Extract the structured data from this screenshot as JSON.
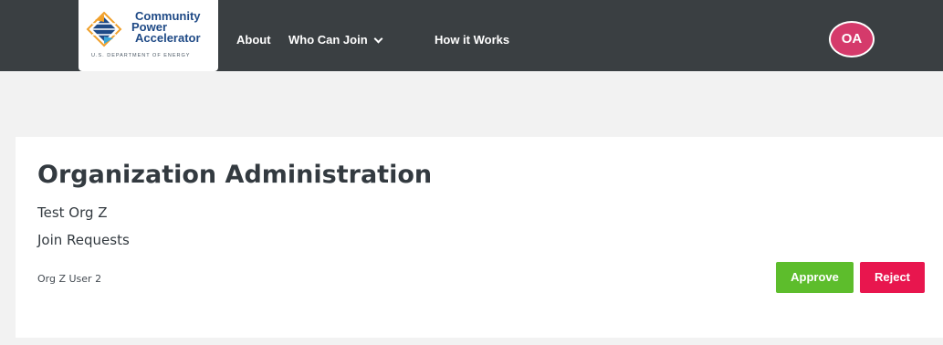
{
  "header": {
    "logo": {
      "line1": "Community",
      "line2": "Power",
      "line3": "Accelerator",
      "subtitle": "U.S. DEPARTMENT OF ENERGY"
    },
    "nav": {
      "about": "About",
      "who_can_join": "Who Can Join",
      "how_it_works": "How it Works"
    },
    "avatar_initials": "OA",
    "avatar_color": "#d53a6b",
    "bar_color": "#3a3f42"
  },
  "main": {
    "title": "Organization Administration",
    "org_name": "Test Org Z",
    "section_title": "Join Requests",
    "requests": [
      {
        "user": "Org Z User 2",
        "approve_label": "Approve",
        "reject_label": "Reject"
      }
    ],
    "approve_color": "#5dbd2c",
    "reject_color": "#e8164e"
  }
}
